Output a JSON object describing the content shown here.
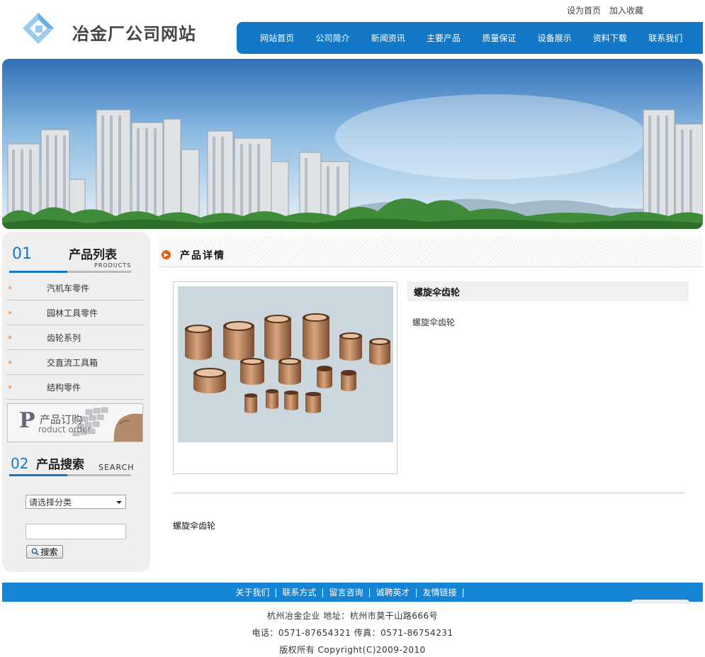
{
  "header": {
    "top_links": [
      "设为首页",
      "加入收藏"
    ],
    "logo_text": "冶金厂公司网站",
    "nav": [
      "网站首页",
      "公司简介",
      "新闻资讯",
      "主要产品",
      "质量保证",
      "设备展示",
      "资料下载",
      "联系我们"
    ],
    "nav_color": "#1278c6"
  },
  "sidebar": {
    "products": {
      "number": "01",
      "title": "产品列表",
      "subtitle": "PRODUCTS",
      "items": [
        "汽机车零件",
        "园林工具零件",
        "齿轮系列",
        "交直流工具箱",
        "结构零件"
      ]
    },
    "order_banner": {
      "letter": "P",
      "title": "产品订购",
      "subtitle": "roduct order"
    },
    "search": {
      "number": "02",
      "title": "产品搜索",
      "subtitle": "SEARCH",
      "select_value": "请选择分类",
      "input_value": "",
      "button_label": "搜索"
    }
  },
  "main": {
    "section_title": "产品详情",
    "product_name": "螺旋伞齿轮",
    "product_short": "螺旋伞齿轮",
    "product_detail": "螺旋伞齿轮"
  },
  "footer": {
    "links": [
      "关于我们",
      "联系方式",
      "留言咨询",
      "诚聘英才",
      "友情链接"
    ],
    "separator": "|",
    "company_line": "杭州冶金企业 地址：杭州市莫干山路666号",
    "contact_line": "电话：0571-87654321 传真：0571-86754231",
    "copyright_line": "版权所有 Copyright(C)2009-2010",
    "bar_color": "#1684d4"
  }
}
